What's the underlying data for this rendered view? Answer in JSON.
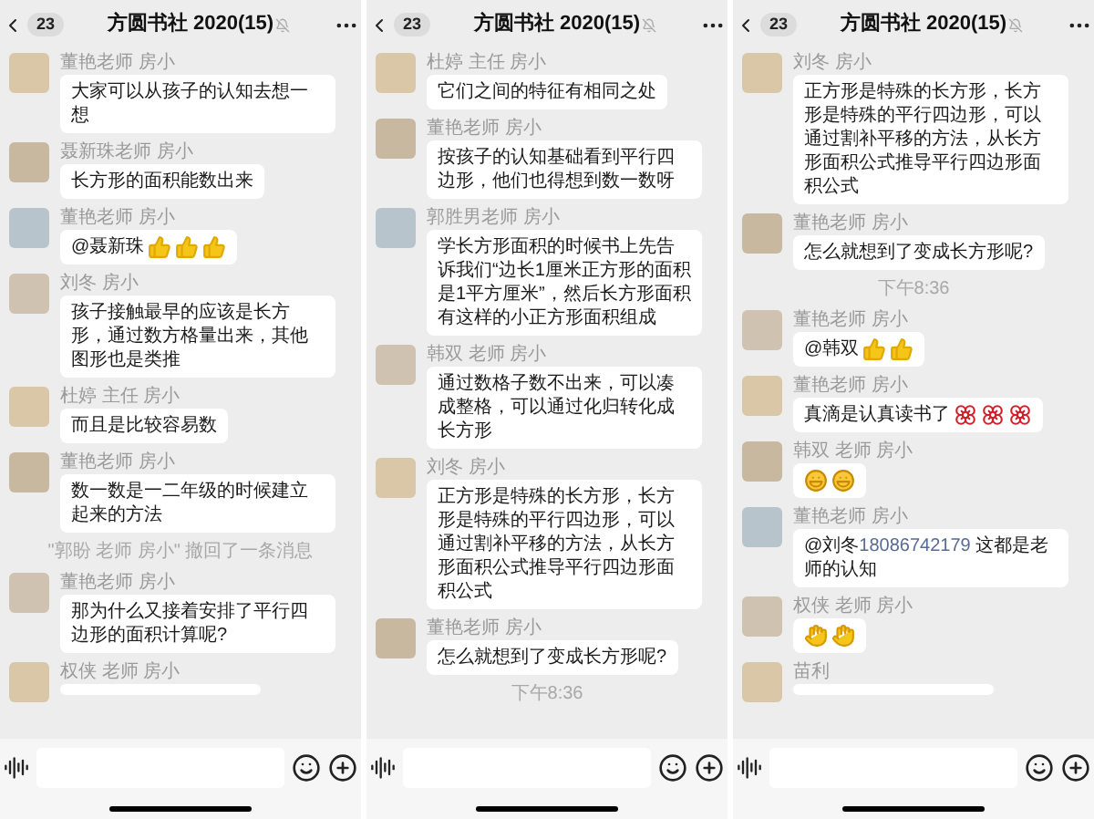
{
  "screens": [
    {
      "header": {
        "badge": "23",
        "title": "方圆书社 2020(15)"
      },
      "messages": [
        {
          "kind": "message",
          "sender": "董艳老师 房小",
          "text": "大家可以从孩子的认知去想一想"
        },
        {
          "kind": "message",
          "sender": "聂新珠老师 房小",
          "text": "长方形的面积能数出来"
        },
        {
          "kind": "message",
          "sender": "董艳老师 房小",
          "text": "@聂新珠",
          "emoji": [
            {
              "kind": "thumbs"
            },
            {
              "kind": "thumbs"
            },
            {
              "kind": "thumbs"
            }
          ]
        },
        {
          "kind": "message",
          "sender": "刘冬 房小",
          "text": "孩子接触最早的应该是长方形，通过数方格量出来，其他图形也是类推"
        },
        {
          "kind": "message",
          "sender": "杜婷 主任 房小",
          "text": "而且是比较容易数"
        },
        {
          "kind": "message",
          "sender": "董艳老师 房小",
          "text": "数一数是一二年级的时候建立起来的方法"
        },
        {
          "kind": "system",
          "text": "\"郭盼 老师 房小\" 撤回了一条消息"
        },
        {
          "kind": "message",
          "sender": "董艳老师 房小",
          "text": "那为什么又接着安排了平行四边形的面积计算呢?"
        },
        {
          "kind": "partial",
          "sender": "权侠 老师 房小"
        }
      ]
    },
    {
      "header": {
        "badge": "23",
        "title": "方圆书社 2020(15)"
      },
      "messages": [
        {
          "kind": "message",
          "sender": "杜婷 主任 房小",
          "text": "它们之间的特征有相同之处"
        },
        {
          "kind": "message",
          "sender": "董艳老师 房小",
          "text": "按孩子的认知基础看到平行四边形，他们也得想到数一数呀"
        },
        {
          "kind": "message",
          "sender": "郭胜男老师 房小",
          "text": "学长方形面积的时候书上先告诉我们“边长1厘米正方形的面积是1平方厘米”，然后长方形面积有这样的小正方形面积组成"
        },
        {
          "kind": "message",
          "sender": "韩双 老师 房小",
          "text": "通过数格子数不出来，可以凑成整格，可以通过化归转化成长方形"
        },
        {
          "kind": "message",
          "sender": "刘冬 房小",
          "text": "正方形是特殊的长方形，长方形是特殊的平行四边形，可以通过割补平移的方法，从长方形面积公式推导平行四边形面积公式"
        },
        {
          "kind": "message",
          "sender": "董艳老师 房小",
          "text": "怎么就想到了变成长方形呢?"
        },
        {
          "kind": "time",
          "text": "下午8:36"
        }
      ]
    },
    {
      "header": {
        "badge": "23",
        "title": "方圆书社 2020(15)"
      },
      "messages": [
        {
          "kind": "message",
          "sender": "刘冬 房小",
          "text": "正方形是特殊的长方形，长方形是特殊的平行四边形，可以通过割补平移的方法，从长方形面积公式推导平行四边形面积公式"
        },
        {
          "kind": "message",
          "sender": "董艳老师 房小",
          "text": "怎么就想到了变成长方形呢?"
        },
        {
          "kind": "time",
          "text": "下午8:36"
        },
        {
          "kind": "message",
          "sender": "董艳老师 房小",
          "text": "@韩双",
          "emoji": [
            {
              "kind": "thumbs"
            },
            {
              "kind": "thumbs"
            }
          ]
        },
        {
          "kind": "message",
          "sender": "董艳老师 房小",
          "text": "真滴是认真读书了",
          "emoji": [
            {
              "kind": "rose"
            },
            {
              "kind": "rose"
            },
            {
              "kind": "rose"
            }
          ]
        },
        {
          "kind": "message",
          "sender": "韩双 老师 房小",
          "emoji": [
            {
              "kind": "grin"
            },
            {
              "kind": "grin"
            }
          ]
        },
        {
          "kind": "message",
          "sender": "董艳老师 房小",
          "parts": [
            {
              "text": "@刘冬"
            },
            {
              "text": "18086742179",
              "link": true
            },
            {
              "text": " 这都是老师的认知"
            }
          ]
        },
        {
          "kind": "message",
          "sender": "权侠 老师 房小",
          "emoji": [
            {
              "kind": "clap"
            },
            {
              "kind": "clap"
            }
          ]
        },
        {
          "kind": "partial",
          "sender": "苗利"
        }
      ]
    }
  ]
}
